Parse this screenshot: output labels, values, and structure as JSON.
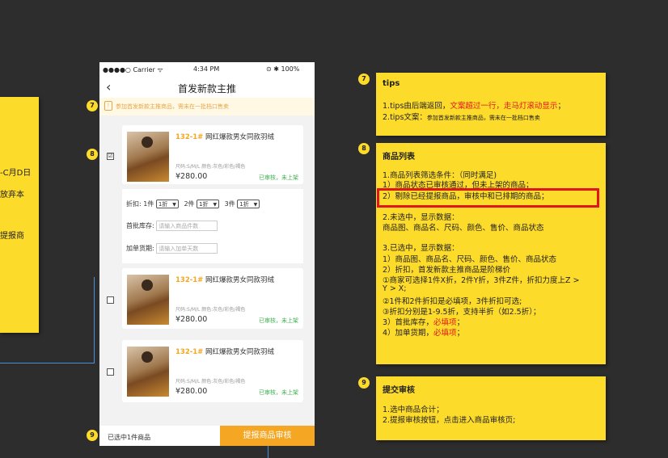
{
  "left_note": {
    "lines": [
      "-C月D日",
      "放弃本",
      "提报商"
    ]
  },
  "phone": {
    "status": {
      "carrier": "●●●●○ Carrier ᯤ",
      "time": "4:34 PM",
      "battery": "⊙ ✱ 100%"
    },
    "title": "首发新款主推",
    "back_glyph": "‹",
    "tip_icon": "!",
    "tip": "参加首发新款主推商品，需未在一批档口售卖",
    "products": [
      {
        "code": "132-1#",
        "name": "网红爆款男女同款羽绒",
        "attr": "尺码:S/M/L   颜色:灰色/彩色/褐色",
        "price": "¥280.00",
        "status": "已审核，未上架",
        "checked": "☑"
      },
      {
        "code": "132-1#",
        "name": "网红爆款男女同款羽绒",
        "attr": "尺码:S/M/L   颜色:灰色/彩色/褐色",
        "price": "¥280.00",
        "status": "已审核，未上架",
        "checked": ""
      },
      {
        "code": "132-1#",
        "name": "网红爆款男女同款羽绒",
        "attr": "尺码:S/M/L   颜色:灰色/彩色/褐色",
        "price": "¥280.00",
        "status": "已审核，未上架",
        "checked": ""
      }
    ],
    "discount": {
      "label": "折扣:",
      "tiers": [
        {
          "qty": "1件",
          "value": "1折"
        },
        {
          "qty": "2件",
          "value": "1折"
        },
        {
          "qty": "3件",
          "value": "1折"
        }
      ],
      "stock_label": "首批库存:",
      "stock_placeholder": "请输入商品件数",
      "days_label": "加单货期:",
      "days_placeholder": "请输入加单天数"
    },
    "bottom": {
      "selected": "已选中1件商品",
      "submit": "提报商品审核"
    }
  },
  "badges": {
    "b7": "7",
    "b8": "8",
    "b9": "9"
  },
  "notes": {
    "n7": {
      "title": "tips",
      "l1a": "1.tips由后端返回，",
      "l1b": "文案超过一行，走马灯滚动显示",
      "l1c": "；",
      "l2a": "2.tips文案：",
      "l2b": "参加首发新款主推商品，需未在一批档口售卖"
    },
    "n8": {
      "title": "商品列表",
      "lines": [
        "1.商品列表筛选条件：（同时满足)",
        "1）商品状态已审核通过，但未上架的商品；",
        "2）剔除已经提报商品，审核中和已排期的商品；",
        "",
        "2.未选中，显示数据：",
        "商品图、商品名、尺码、颜色、售价、商品状态",
        "",
        "3.已选中，显示数据：",
        "1）商品图、商品名、尺码、颜色、售价、商品状态",
        "2）折扣，首发新款主推商品是阶梯价",
        "①商家可选择1件X折，2件Y折，3件Z件，折扣力度上Z >",
        "Y > X;",
        "②1件和2件折扣是必填项，3件折扣可选;",
        "③折扣分别是1-9.5折，支持半折（如2.5折）；"
      ],
      "l3a": "3）首批库存，",
      "l3b": "必填项",
      "l3c": "；",
      "l4a": "4）加单货期，",
      "l4b": "必填项",
      "l4c": "；"
    },
    "n9": {
      "title": "提交审核",
      "lines": [
        "1.选中商品合计；",
        "2.提报审核按钮，点击进入商品审核页;"
      ]
    }
  }
}
